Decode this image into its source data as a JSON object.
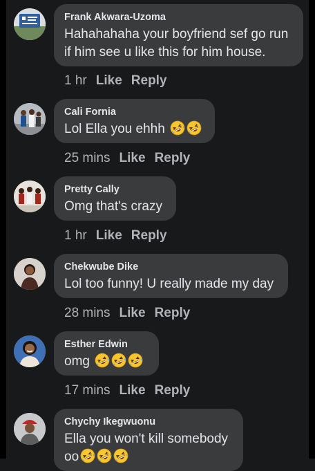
{
  "comments": [
    {
      "author": "Frank Akwara-Uzoma",
      "text_lines": [
        "Hahahahaha your boyfriend sef go run",
        "if him see u like this for him house."
      ],
      "emoji_count": 0,
      "time": "1 hr",
      "like_label": "Like",
      "reply_label": "Reply",
      "avatar_icon": "building-sign-avatar"
    },
    {
      "author": "Cali Fornia",
      "text_lines": [
        "Lol Ella you ehhh"
      ],
      "emoji_count": 2,
      "emoji": "rolling-on-floor-laughing",
      "time": "25 mins",
      "like_label": "Like",
      "reply_label": "Reply",
      "avatar_icon": "group-photo-avatar"
    },
    {
      "author": "Pretty Cally",
      "text_lines": [
        "Omg that's crazy"
      ],
      "emoji_count": 0,
      "time": "1 hr",
      "like_label": "Like",
      "reply_label": "Reply",
      "avatar_icon": "dancers-avatar"
    },
    {
      "author": "Chekwube Dike",
      "text_lines": [
        "Lol too funny! U really made my day"
      ],
      "emoji_count": 0,
      "time": "28 mins",
      "like_label": "Like",
      "reply_label": "Reply",
      "avatar_icon": "woman-portrait-avatar"
    },
    {
      "author": "Esther Edwin",
      "text_lines": [
        "omg"
      ],
      "emoji_count": 3,
      "emoji": "rolling-on-floor-laughing",
      "time": "17 mins",
      "like_label": "Like",
      "reply_label": "Reply",
      "avatar_icon": "smiling-woman-avatar"
    },
    {
      "author": "Chychy Ikegwuonu",
      "text_lines": [
        "Ella you won't kill somebody",
        "oo"
      ],
      "emoji_count": 3,
      "emoji": "rolling-on-floor-laughing",
      "time": "",
      "like_label": "",
      "reply_label": "",
      "avatar_icon": "red-hat-avatar"
    }
  ],
  "colors": {
    "background": "#18191a",
    "bubble": "#3a3b3c",
    "text": "#e4e6eb",
    "secondary_text": "#b0b3b8",
    "frame": "#000000"
  }
}
